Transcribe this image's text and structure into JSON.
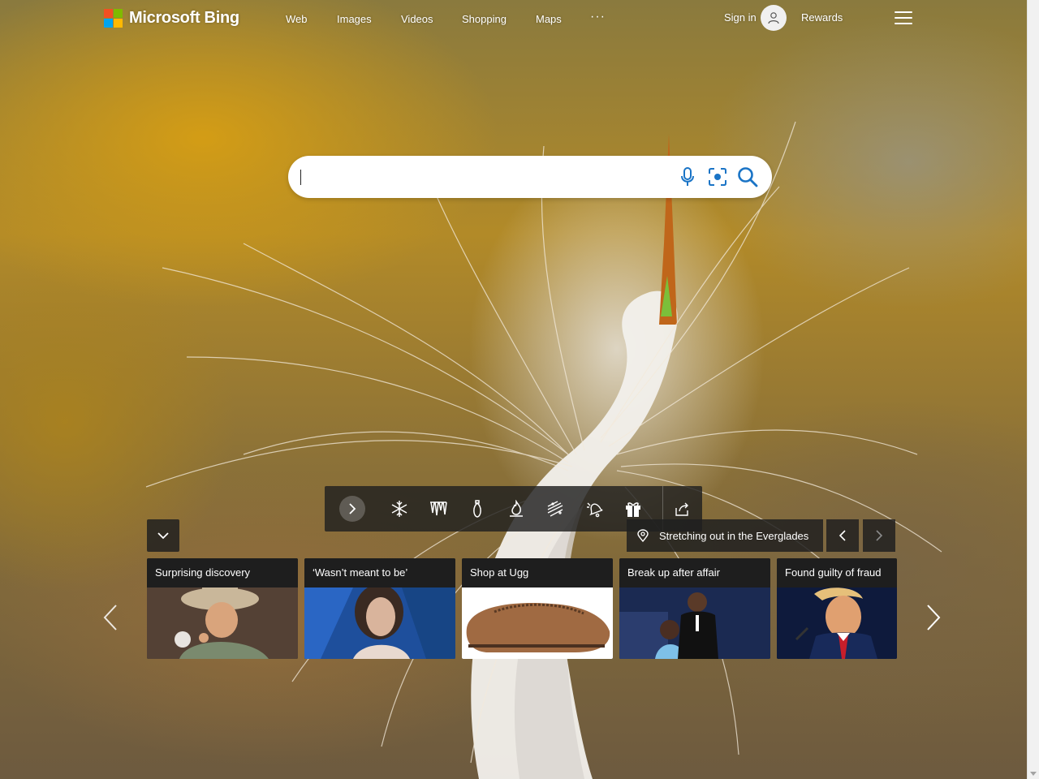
{
  "header": {
    "logo_text": "Microsoft Bing",
    "nav": [
      {
        "label": "Web",
        "key": "web"
      },
      {
        "label": "Images",
        "key": "images"
      },
      {
        "label": "Videos",
        "key": "videos"
      },
      {
        "label": "Shopping",
        "key": "shopping"
      },
      {
        "label": "Maps",
        "key": "maps"
      },
      {
        "label": "···",
        "key": "more"
      }
    ],
    "sign_in": "Sign in",
    "rewards": "Rewards",
    "icons": {
      "avatar": "person-icon",
      "menu": "hamburger-menu-icon"
    }
  },
  "search": {
    "value": "",
    "placeholder": "",
    "icons": [
      "microphone-icon",
      "visual-search-icon",
      "search-icon"
    ]
  },
  "toolbar": {
    "icons": [
      "next-icon",
      "snowflake-icon",
      "icicles-icon",
      "ornament-icon",
      "fire-icon",
      "wind-snow-icon",
      "bell-icon",
      "gift-icon",
      "share-icon"
    ]
  },
  "image_info": {
    "title": "Stretching out in the Everglades",
    "icons": {
      "location": "location-pin-icon",
      "prev": "chevron-left-icon",
      "next": "chevron-right-icon",
      "collapse": "chevron-down-icon"
    }
  },
  "news_cards": [
    {
      "title": "Surprising discovery"
    },
    {
      "title": "‘Wasn’t meant to be’"
    },
    {
      "title": "Shop at Ugg"
    },
    {
      "title": "Break up after affair"
    },
    {
      "title": "Found guilty of fraud"
    }
  ],
  "colors": {
    "ms_red": "#f25022",
    "ms_green": "#7fba00",
    "ms_blue": "#00a4ef",
    "ms_yellow": "#ffb900",
    "search_icon_blue": "#1a74c6",
    "panel_dark": "#202020"
  }
}
